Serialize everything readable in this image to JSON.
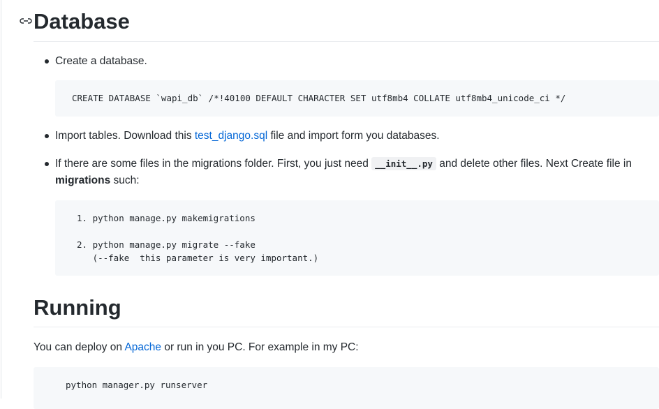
{
  "database_section": {
    "title": "Database",
    "item1": {
      "text": "Create a database.",
      "code": "CREATE DATABASE `wapi_db` /*!40100 DEFAULT CHARACTER SET utf8mb4 COLLATE utf8mb4_unicode_ci */"
    },
    "item2": {
      "before": "Import tables. Download this ",
      "link": "test_django.sql",
      "after": " file and import form you databases."
    },
    "item3": {
      "before": "If there are some files in the migrations folder. First, you just need ",
      "code": "__init__.py",
      "after": " and delete other files. Next Create file in",
      "line2_bold": "migrations",
      "line2_after": " such:",
      "code_lines": [
        "1. python manage.py makemigrations",
        "",
        "2. python manage.py migrate --fake",
        "   (--fake  this parameter is very important.)"
      ]
    }
  },
  "running_section": {
    "title": "Running",
    "para": {
      "before": "You can deploy on ",
      "link": "Apache",
      "after": " or run in you PC. For example in my PC:"
    },
    "code": "python manager.py runserver"
  }
}
